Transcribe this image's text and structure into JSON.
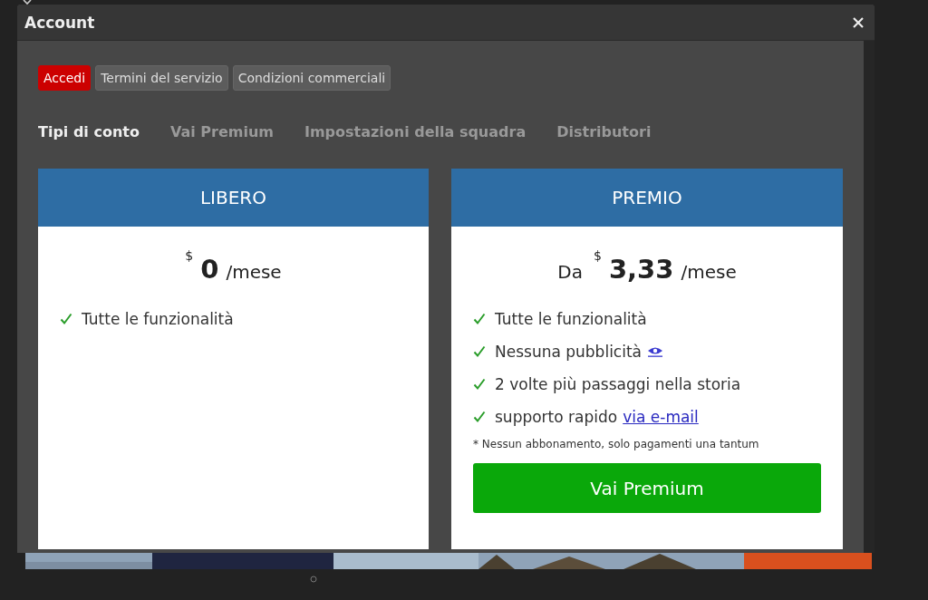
{
  "dialog": {
    "title": "Account"
  },
  "buttons": [
    {
      "label": "Accedi",
      "selected": true
    },
    {
      "label": "Termini del servizio",
      "selected": false
    },
    {
      "label": "Condizioni commerciali",
      "selected": false
    }
  ],
  "tabs": [
    {
      "label": "Tipi di conto",
      "selected": true
    },
    {
      "label": "Vai Premium",
      "selected": false
    },
    {
      "label": "Impostazioni della squadra",
      "selected": false
    },
    {
      "label": "Distributori",
      "selected": false
    }
  ],
  "plans": [
    {
      "name": "LIBERO",
      "currency": "$",
      "amount": "0",
      "period": "/mese",
      "features": [
        {
          "kind": "plain",
          "text": "Tutte le funzionalità"
        }
      ]
    },
    {
      "name": "PREMIO",
      "prefix": "Da",
      "currency": "$",
      "amount": "3,33",
      "period": "/mese",
      "features": [
        {
          "kind": "plain",
          "text": "Tutte le funzionalità"
        },
        {
          "kind": "eye",
          "text": "Nessuna pubblicità"
        },
        {
          "kind": "plain",
          "text": "2 volte più passaggi nella storia"
        },
        {
          "kind": "link",
          "text": "supporto rapido",
          "link": "via e-mail"
        }
      ],
      "note": "* Nessun abbonamento, solo pagamenti una tantum",
      "button": "Vai Premium"
    }
  ]
}
